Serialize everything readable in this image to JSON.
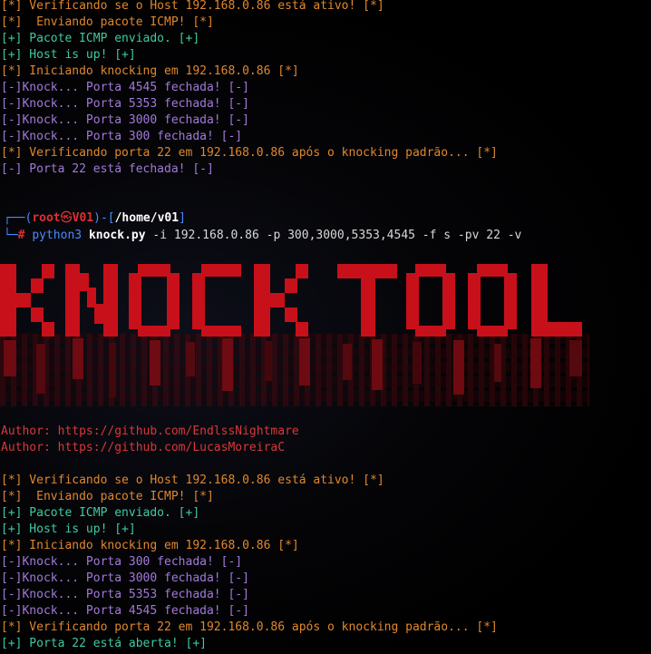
{
  "colors": {
    "bracket_info": "#e0872c",
    "bracket_success": "#3fc9a1",
    "bracket_fail": "#a07ad8",
    "prompt_blue": "#4a8bff",
    "prompt_red": "#e03030",
    "banner_red": "#c8101a"
  },
  "session1": {
    "lines": [
      "[*] Verificando se o Host 192.168.0.86 está ativo! [*]",
      "[*]  Enviando pacote ICMP! [*]",
      "[+] Pacote ICMP enviado. [+]",
      "[+] Host is up! [+]",
      "[*] Iniciando knocking em 192.168.0.86 [*]",
      "[-]Knock... Porta 4545 fechada! [-]",
      "[-]Knock... Porta 5353 fechada! [-]",
      "[-]Knock... Porta 3000 fechada! [-]",
      "[-]Knock... Porta 300 fechada! [-]",
      "[*] Verificando porta 22 em 192.168.0.86 após o knocking padrão... [*]",
      "[-] Porta 22 está fechada! [-]"
    ]
  },
  "prompt": {
    "user": "root",
    "at_symbol": "㉿",
    "host": "V01",
    "path": "/home/v01",
    "symbol": "#",
    "command": "python3",
    "script": "knock.py",
    "args": "-i 192.168.0.86 -p 300,3000,5353,4545 -f s -pv 22 -v"
  },
  "banner": {
    "text": "KNOCK TOOL"
  },
  "authors": [
    "Author: https://github.com/EndlssNightmare",
    "Author: https://github.com/LucasMoreiraC"
  ],
  "session2": {
    "lines": [
      "[*] Verificando se o Host 192.168.0.86 está ativo! [*]",
      "[*]  Enviando pacote ICMP! [*]",
      "[+] Pacote ICMP enviado. [+]",
      "[+] Host is up! [+]",
      "[*] Iniciando knocking em 192.168.0.86 [*]",
      "[-]Knock... Porta 300 fechada! [-]",
      "[-]Knock... Porta 3000 fechada! [-]",
      "[-]Knock... Porta 5353 fechada! [-]",
      "[-]Knock... Porta 4545 fechada! [-]",
      "[*] Verificando porta 22 em 192.168.0.86 após o knocking padrão... [*]",
      "[+] Porta 22 está aberta! [+]"
    ]
  }
}
